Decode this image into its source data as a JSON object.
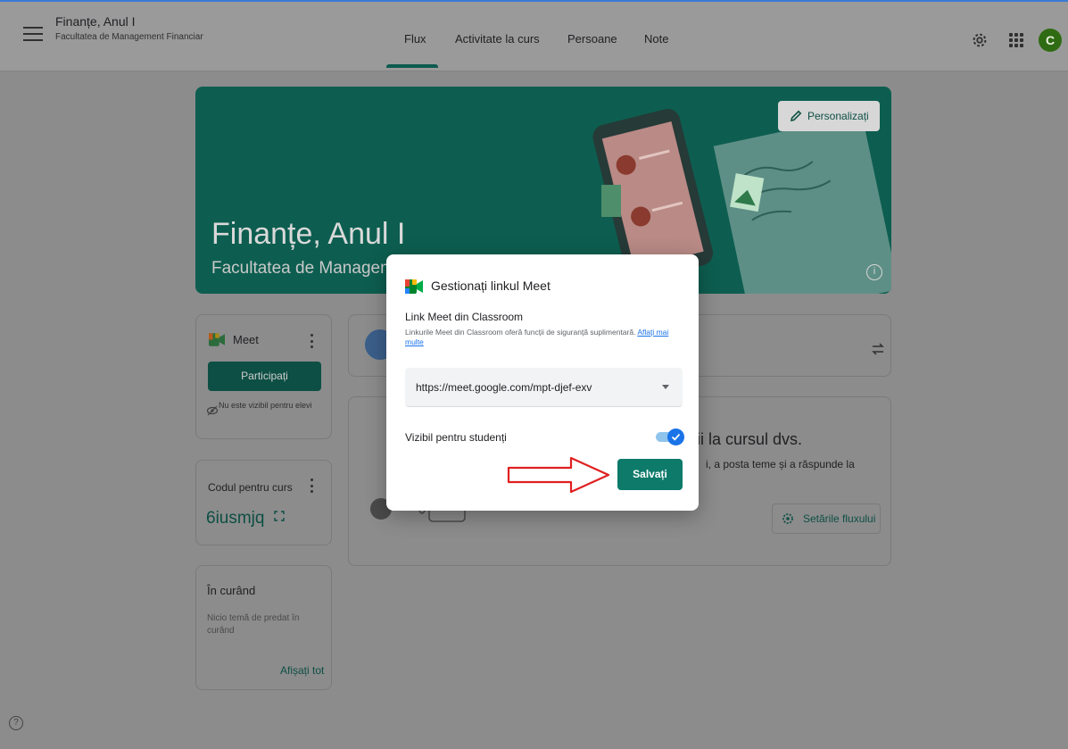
{
  "header": {
    "course_title": "Finanțe, Anul I",
    "course_subtitle": "Facultatea de Management Financiar",
    "tabs": [
      {
        "label": "Flux",
        "active": true
      },
      {
        "label": "Activitate la curs"
      },
      {
        "label": "Persoane"
      },
      {
        "label": "Note"
      }
    ],
    "avatar_letter": "C"
  },
  "banner": {
    "title": "Finanțe, Anul I",
    "subtitle": "Facultatea de Manageme",
    "personalize_label": "Personalizați"
  },
  "meet_card": {
    "label": "Meet",
    "join_label": "Participați",
    "visibility_note": "Nu este vizibil pentru elevi"
  },
  "code_card": {
    "label": "Codul pentru curs",
    "code": "6iusmjq"
  },
  "upcoming_card": {
    "title": "În curând",
    "text": "Nicio temă de predat în curând",
    "show_all_label": "Afișați tot"
  },
  "stream_card": {
    "heading": "ții la cursul dvs.",
    "text": "i, a posta teme și a răspunde la",
    "settings_label": "Setările fluxului"
  },
  "dialog": {
    "title": "Gestionați linkul Meet",
    "subtitle": "Link Meet din Classroom",
    "description": "Linkurile Meet din Classroom oferă funcții de siguranță suplimentară.",
    "learn_more": "Aflați mai multe",
    "selected_link": "https://meet.google.com/mpt-djef-exv",
    "visible_label": "Vizibil pentru studenți",
    "visible_on": true,
    "save_label": "Salvați"
  },
  "colors": {
    "accent": "#0d7a6a",
    "toggle_blue": "#1a73e8",
    "annotation_red": "#e02020"
  }
}
